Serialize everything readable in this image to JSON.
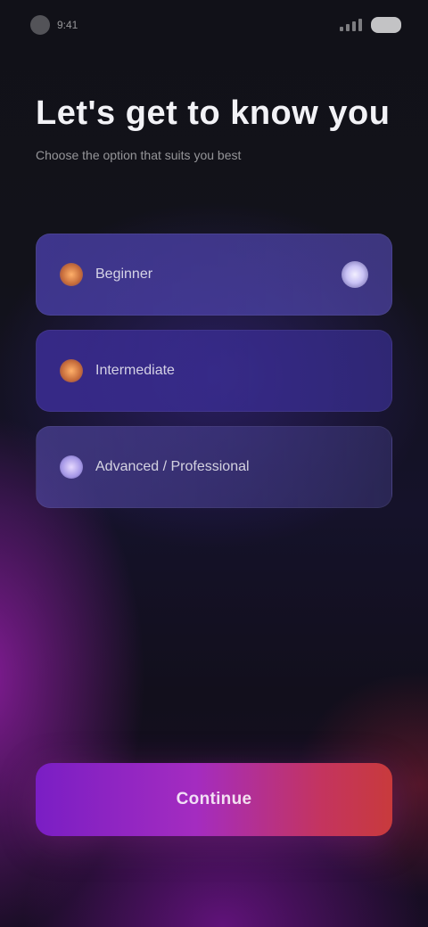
{
  "status_bar": {
    "time": "9:41",
    "icons": [
      "camera-dot-icon",
      "signal-icon",
      "battery-icon"
    ]
  },
  "header": {
    "title": "Let's get to know you",
    "subtitle": "Choose the option that suits you best"
  },
  "options": [
    {
      "label": "Beginner",
      "icon": "flame-icon",
      "glyph": "●",
      "selected": true
    },
    {
      "label": "Intermediate",
      "icon": "fire-icon",
      "glyph": "●",
      "selected": false
    },
    {
      "label": "Advanced / Professional",
      "icon": "star-icon",
      "glyph": "●",
      "selected": false
    }
  ],
  "cta": {
    "label": "Continue"
  },
  "colors": {
    "background": "#111118",
    "accent_start": "#7a1ec4",
    "accent_end": "#c83a3c",
    "option_fill": "#4a3ea0"
  }
}
